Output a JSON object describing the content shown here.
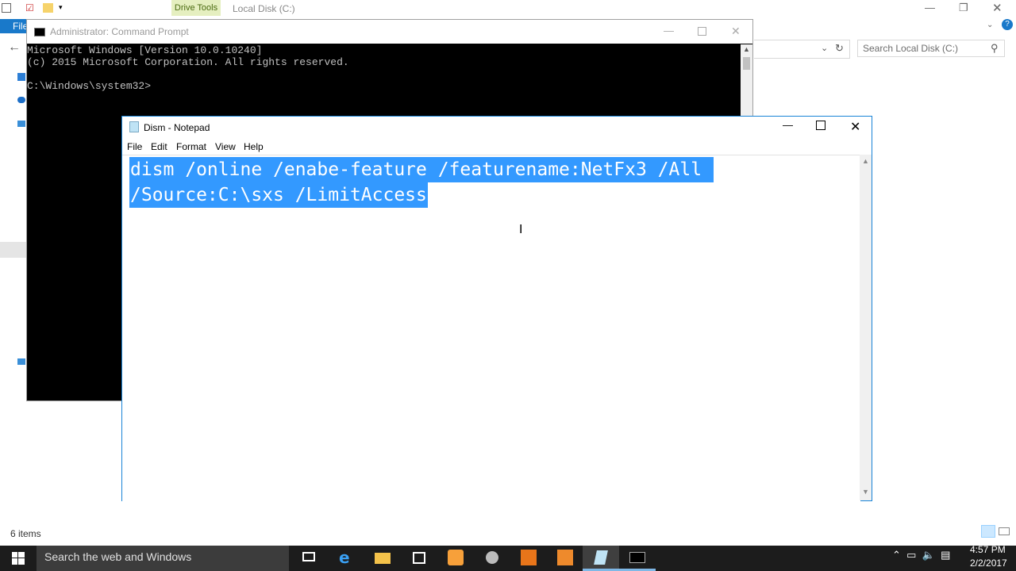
{
  "explorer": {
    "drive_tools": "Drive Tools",
    "title": "Local Disk (C:)",
    "file_tab": "File",
    "search_placeholder": "Search Local Disk (C:)",
    "status": "6 items"
  },
  "cmd": {
    "title": "Administrator: Command Prompt",
    "lines": "Microsoft Windows [Version 10.0.10240]\n(c) 2015 Microsoft Corporation. All rights reserved.\n\nC:\\Windows\\system32>"
  },
  "notepad": {
    "title": "Dism - Notepad",
    "menu": [
      "File",
      "Edit",
      "Format",
      "View",
      "Help"
    ],
    "line1": "dism /online /enabe-feature /featurename:NetFx3 /All ",
    "line2": "/Source:C:\\sxs /LimitAccess"
  },
  "taskbar": {
    "search_placeholder": "Search the web and Windows",
    "time": "4:57 PM",
    "date": "2/2/2017"
  },
  "colors": {
    "selection": "#3399ff",
    "notepad_border": "#1883d7",
    "taskbar": "#1c1c1c"
  }
}
